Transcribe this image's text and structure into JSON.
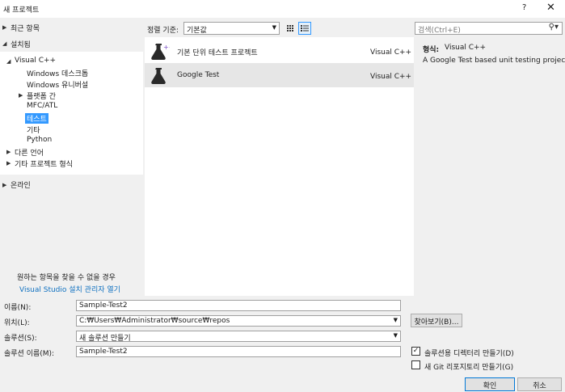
{
  "window": {
    "title": "새 프로젝트",
    "help_label": "?",
    "close_label": "✕"
  },
  "nav": {
    "recent": "최근 항목",
    "installed": "설치됨",
    "visual_cpp": "Visual C++",
    "windows_desktop": "Windows 데스크톱",
    "windows_universal": "Windows 유니버설",
    "cross_platform": "플랫폼 간",
    "mfc_atl": "MFC/ATL",
    "test": "테스트",
    "other": "기타",
    "python": "Python",
    "other_languages": "다른 언어",
    "other_project_types": "기타 프로젝트 형식",
    "online": "온라인",
    "not_finding": "원하는 항목을 찾을 수 없을 경우",
    "installer_link": "Visual Studio 설치 관리자 열기"
  },
  "toolbar": {
    "sort_label": "정렬 기준:",
    "sort_value": "기본값",
    "search_placeholder": "검색(Ctrl+E)"
  },
  "templates": [
    {
      "name": "기본 단위 테스트 프로젝트",
      "language": "Visual C++",
      "selected": false,
      "icon": "unit-test-flask-icon"
    },
    {
      "name": "Google Test",
      "language": "Visual C++",
      "selected": true,
      "icon": "flask-icon"
    }
  ],
  "detail": {
    "type_label": "형식:",
    "type_value": "Visual C++",
    "description": "A Google Test based unit testing project."
  },
  "form": {
    "name_label": "이름(N):",
    "name_value": "Sample-Test2",
    "location_label": "위치(L):",
    "location_value": "C:₩Users₩Administrator₩source₩repos",
    "browse_label": "찾아보기(B)...",
    "solution_label": "솔루션(S):",
    "solution_value": "새 솔루션 만들기",
    "solution_name_label": "솔루션 이름(M):",
    "solution_name_value": "Sample-Test2",
    "create_dir_label": "솔루션용 디렉터리 만들기(D)",
    "create_dir_checked": true,
    "git_repo_label": "새 Git 리포지토리 만들기(G)",
    "git_repo_checked": false,
    "ok_label": "확인",
    "cancel_label": "취소"
  },
  "colors": {
    "selection": "#3399ff",
    "link": "#0e70c0",
    "background": "#f0f0f0"
  }
}
